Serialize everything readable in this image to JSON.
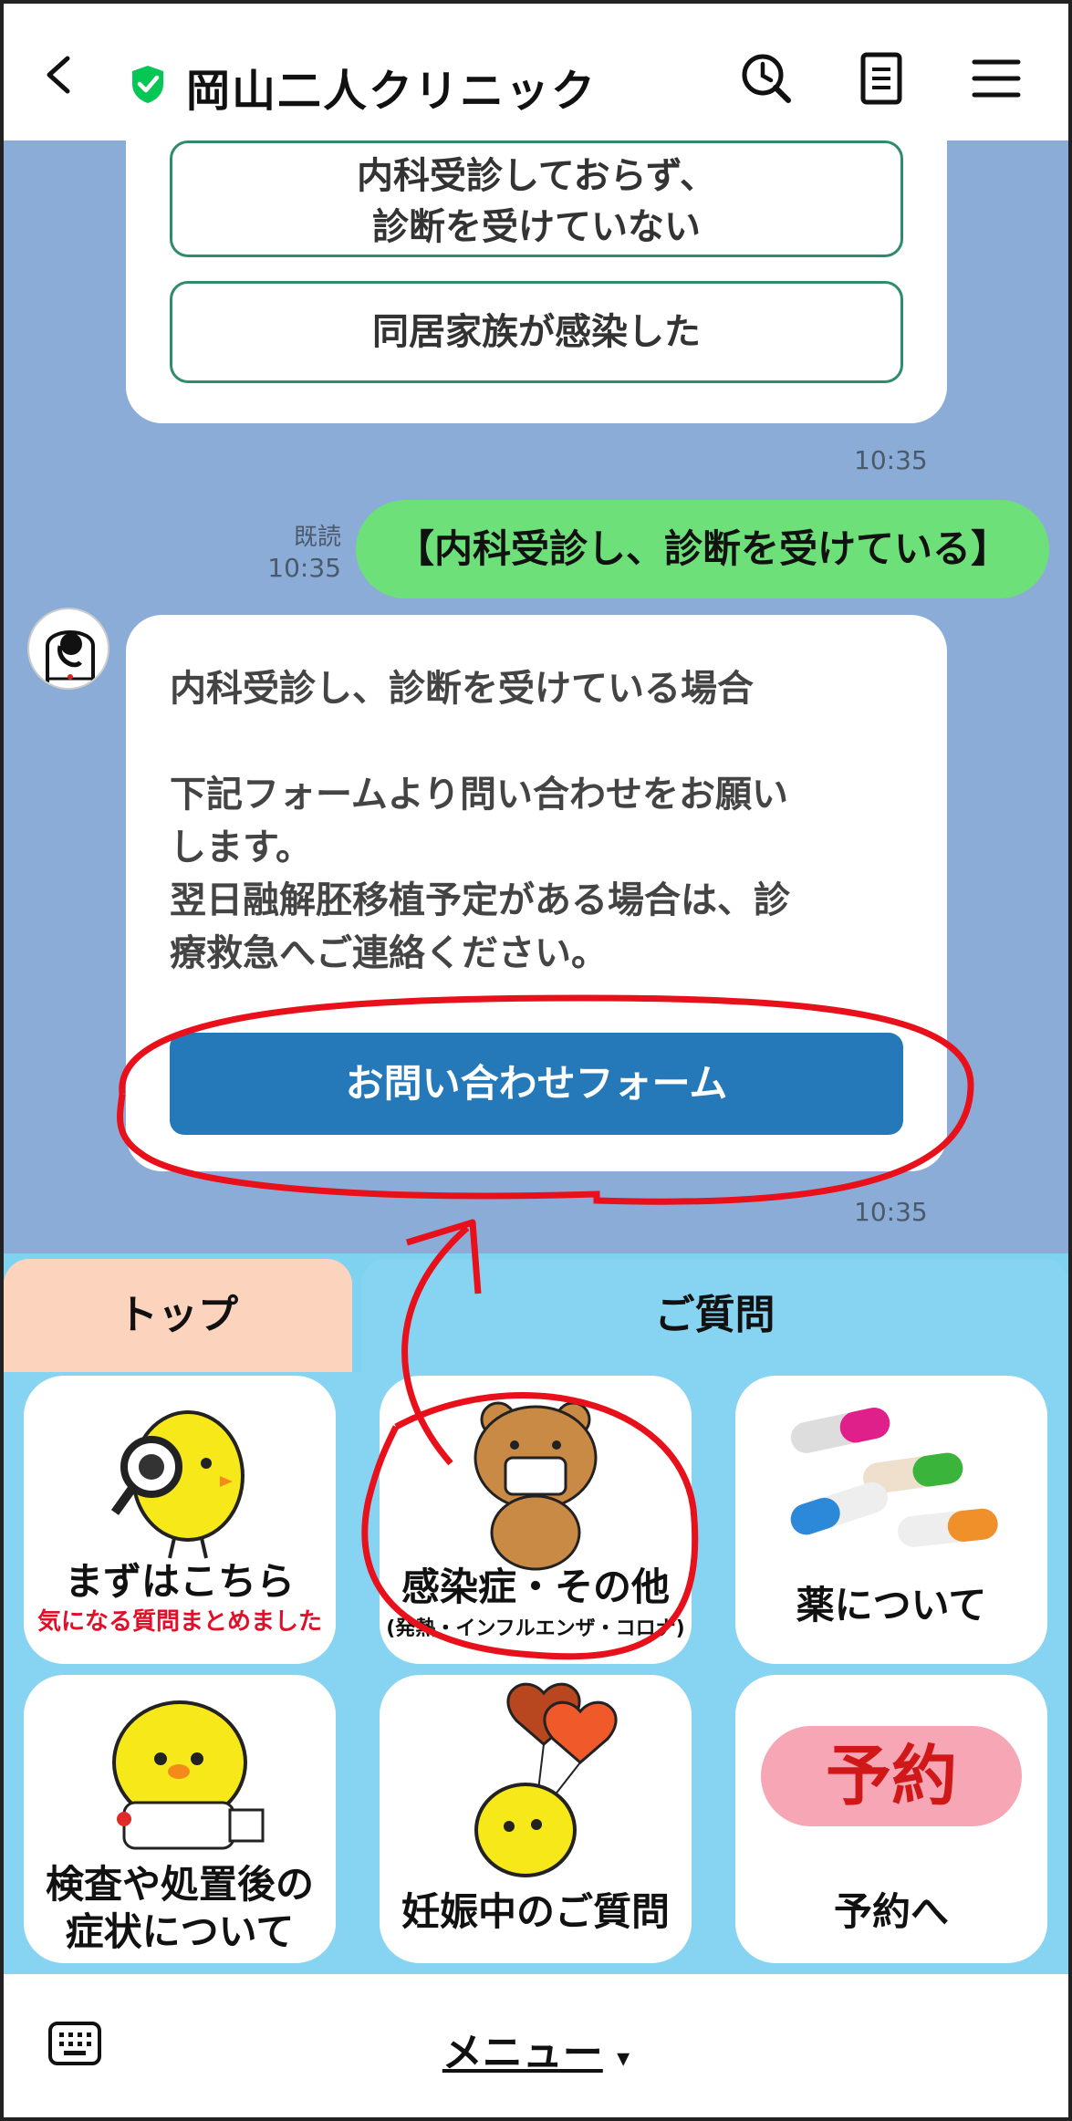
{
  "header": {
    "title": "岡山二人クリニック",
    "icons": [
      "back-chevron-icon",
      "verified-shield-icon",
      "history-search-icon",
      "notes-icon",
      "hamburger-menu-icon"
    ],
    "shield_color": "#06c755"
  },
  "chat": {
    "prev_card": {
      "option1_line1": "内科受診しておらず、",
      "option1_line2": "診断を受けていない",
      "option2": "同居家族が感染した",
      "time": "10:35"
    },
    "my_message": {
      "read": "既読",
      "time": "10:35",
      "text": "【内科受診し、診断を受けている】"
    },
    "reply": {
      "title": "内科受診し、診断を受けている場合",
      "body_line1": "下記フォームより問い合わせをお願い",
      "body_line2": "します。",
      "body_line3": "翌日融解胚移植予定がある場合は、診",
      "body_line4": "療救急へご連絡ください。",
      "button": "お問い合わせフォーム",
      "time": "10:35"
    }
  },
  "rich_menu": {
    "tabs": [
      "トップ",
      "ご質問"
    ],
    "tiles": [
      {
        "label": "まずはこちら",
        "sub": "気になる質問まとめました"
      },
      {
        "label": "感染症・その他",
        "sub": "(発熱・インフルエンザ・コロナ)"
      },
      {
        "label": "薬について",
        "sub": ""
      },
      {
        "label_line1": "検査や処置後の",
        "label_line2": "症状について"
      },
      {
        "label": "妊娠中のご質問"
      },
      {
        "badge": "予約",
        "label": "予約へ"
      }
    ]
  },
  "bottom_bar": {
    "menu_label": "メニュー",
    "menu_caret": "▾"
  },
  "colors": {
    "chat_bg": "#8cacd8",
    "my_bubble": "#6ee07a",
    "button_blue": "#2679b8",
    "tab_top": "#fcd3bd",
    "menu_bg": "#86d4f2",
    "annotation_red": "#e8101a"
  }
}
